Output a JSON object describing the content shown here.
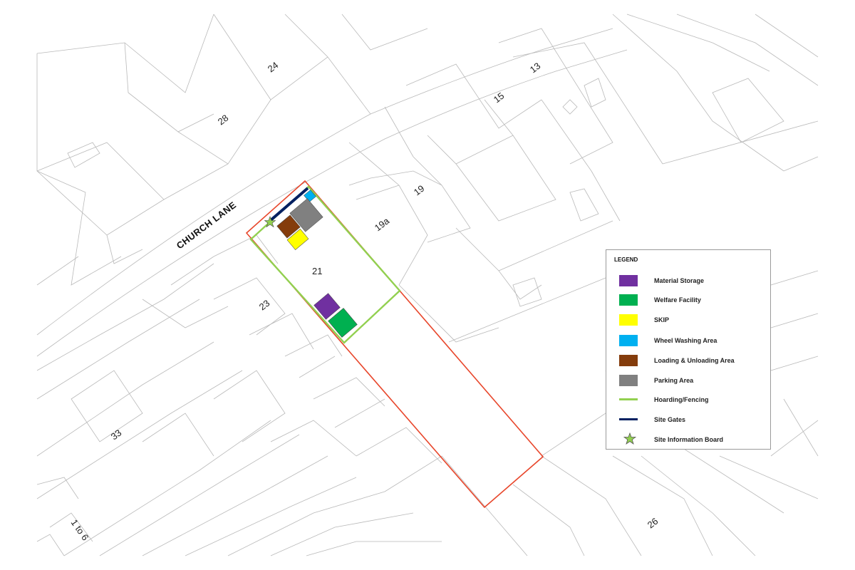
{
  "map": {
    "road_label": "CHURCH LANE",
    "plot_labels": {
      "p24": "24",
      "p28": "28",
      "p13": "13",
      "p15": "15",
      "p19": "19",
      "p19a": "19a",
      "p21": "21",
      "p23": "23",
      "p33": "33",
      "p1to6": "1 to 6",
      "p26": "26"
    }
  },
  "legend": {
    "title": "LEGEND",
    "items": [
      {
        "key": "material",
        "label": "Material Storage",
        "type": "box",
        "color": "#7030a0"
      },
      {
        "key": "welfare",
        "label": "Welfare Facility",
        "type": "box",
        "color": "#00b050"
      },
      {
        "key": "skip",
        "label": "SKIP",
        "type": "box",
        "color": "#ffff00"
      },
      {
        "key": "wheel",
        "label": "Wheel Washing Area",
        "type": "box",
        "color": "#00b0f0"
      },
      {
        "key": "loading",
        "label": "Loading & Unloading Area",
        "type": "box",
        "color": "#843c0c"
      },
      {
        "key": "parking",
        "label": "Parking Area",
        "type": "box",
        "color": "#808080"
      },
      {
        "key": "hoarding",
        "label": "Hoarding/Fencing",
        "type": "line",
        "color": "#92d050"
      },
      {
        "key": "gates",
        "label": "Site Gates",
        "type": "line",
        "color": "#002060"
      },
      {
        "key": "board",
        "label": "Site Information Board",
        "type": "star",
        "color": "#92d050"
      }
    ]
  },
  "colors": {
    "boundary": "#e8472c",
    "hoarding": "#92d050",
    "gates": "#002060",
    "linework": "#b9b9b9"
  }
}
